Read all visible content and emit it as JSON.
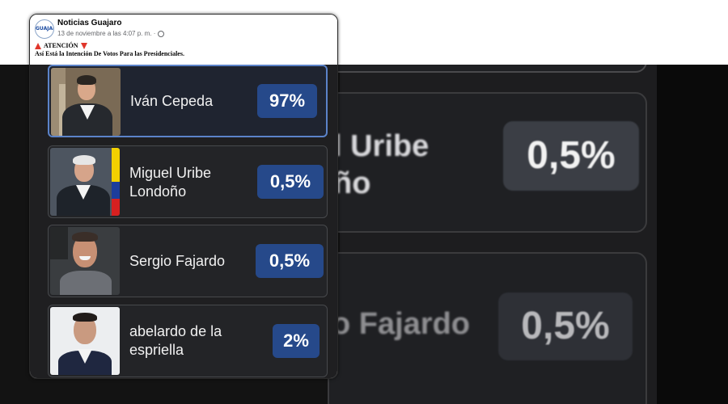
{
  "post": {
    "page_name": "Noticias Guajaro",
    "timestamp": "13 de noviembre a las 4:07 p. m. ·",
    "avatar_text": "GUAJARO",
    "caption_line1": "ATENCIÓN",
    "caption_line2": "Así Está la Intención De Votos Para las Presidenciales."
  },
  "poll": {
    "options": [
      {
        "name": "Iván Cepeda",
        "percent": "97%"
      },
      {
        "name": "Miguel Uribe\nLondoño",
        "percent": "0,5%"
      },
      {
        "name": "Sergio Fajardo",
        "percent": "0,5%"
      },
      {
        "name": "abelardo de la\nespriella",
        "percent": "2%"
      }
    ]
  },
  "background_zoom": {
    "name_top": "l Uribe\nño",
    "pct_top": "0,5%",
    "name_bottom": "o Fajardo",
    "pct_bottom": "0,5%"
  },
  "colors": {
    "percent_badge": "#26498a",
    "selected_border": "#5b83c9",
    "alert_red": "#e0362b"
  }
}
